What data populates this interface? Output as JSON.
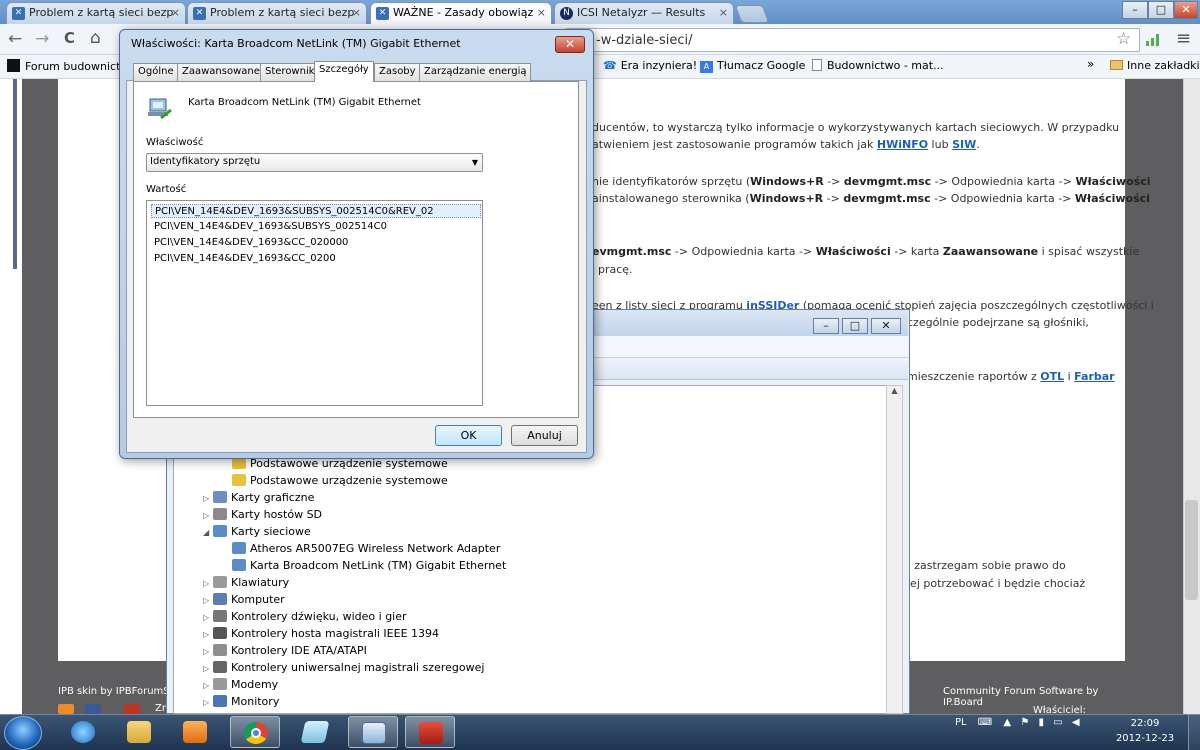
{
  "browser": {
    "tabs": [
      {
        "title": "Problem z kartą sieci bezp",
        "close": "×"
      },
      {
        "title": "Problem z kartą sieci bezp",
        "close": "×"
      },
      {
        "title": "WAŻNE - Zasady obowiąz",
        "close": "×"
      },
      {
        "title": "ICSI Netalyzr — Results",
        "close": "×"
      }
    ],
    "window_buttons": {
      "minimize": "–",
      "maximize": "□",
      "close": "✕"
    },
    "nav": {
      "back": "←",
      "forward": "→",
      "reload": "C",
      "home": "⌂",
      "star": "☆",
      "menu": "≡"
    },
    "url": "-w-dziale-sieci/",
    "bookmarks": {
      "first": "Forum budownictw",
      "items": [
        "Era inzyniera!",
        "Tłumacz Google",
        "Budownictwo - mat..."
      ],
      "chevron": "»",
      "other": "Inne zakładki"
    }
  },
  "page": {
    "lines": [
      {
        "segments": [
          {
            "t": "ducentów, to wystarczą tylko informacje o wykorzystywanych kartach sieciowych. W przypadku",
            "s": "n"
          }
        ]
      },
      {
        "segments": [
          {
            "t": "atwieniem jest zastosowanie programów takich jak ",
            "s": "n"
          },
          {
            "t": "HWiNFO",
            "s": "l"
          },
          {
            "t": " lub ",
            "s": "n"
          },
          {
            "t": "SIW",
            "s": "l"
          },
          {
            "t": ".",
            "s": "n"
          }
        ]
      },
      {
        "segments": [
          {
            "t": "nie identyfikatorów sprzętu (",
            "s": "n"
          },
          {
            "t": "Windows+R",
            "s": "b"
          },
          {
            "t": " -> ",
            "s": "n"
          },
          {
            "t": "devmgmt.msc",
            "s": "b"
          },
          {
            "t": " -> Odpowiednia karta -> ",
            "s": "n"
          },
          {
            "t": "Właściwości",
            "s": "b"
          }
        ]
      },
      {
        "segments": [
          {
            "t": "ainstalowanego sterownika (",
            "s": "n"
          },
          {
            "t": "Windows+R",
            "s": "b"
          },
          {
            "t": " -> ",
            "s": "n"
          },
          {
            "t": "devmgmt.msc",
            "s": "b"
          },
          {
            "t": " -> Odpowiednia karta -> ",
            "s": "n"
          },
          {
            "t": "Właściwości",
            "s": "b"
          }
        ]
      },
      {
        "segments": [
          {
            "t": "evmgmt.msc",
            "s": "b"
          },
          {
            "t": " -> Odpowiednia karta -> ",
            "s": "n"
          },
          {
            "t": "Właściwości",
            "s": "b"
          },
          {
            "t": " -> karta ",
            "s": "n"
          },
          {
            "t": "Zaawansowane",
            "s": "b"
          },
          {
            "t": " i spisać wszystkie",
            "s": "n"
          }
        ]
      },
      {
        "segments": [
          {
            "t": "pracę.",
            "s": "n"
          }
        ]
      },
      {
        "segments": [
          {
            "t": "een z listy sieci z programu ",
            "s": "n"
          },
          {
            "t": "inSSIDer",
            "s": "l"
          },
          {
            "t": " (pomaga ocenić stopień zajęcia poszczególnych częstotliwości i",
            "s": "n"
          }
        ]
      },
      {
        "segments": [
          {
            "t": "czególnie podejrzane są głośniki,",
            "s": "n"
          }
        ]
      },
      {
        "segments": [
          {
            "t": "mieszczenie raportów z ",
            "s": "n"
          },
          {
            "t": "OTL",
            "s": "l"
          },
          {
            "t": " i ",
            "s": "n"
          },
          {
            "t": "Farbar",
            "s": "l"
          }
        ]
      },
      {
        "segments": [
          {
            "t": "; zastrzegam sobie prawo do",
            "s": "n"
          }
        ]
      },
      {
        "segments": [
          {
            "t": " jej potrzebować i będzie chociaż",
            "s": "n"
          }
        ]
      }
    ],
    "footer_left": "IPB skin by IPBForumSki",
    "footer_right": "Community Forum Software by IP.Board",
    "footer_extra_left": "Zr",
    "footer_extra_right": "Właściciel: Fixitpc.pl"
  },
  "device_manager": {
    "window_buttons": {
      "minimize": "–",
      "maximize": "□",
      "close": "✕"
    },
    "tree": [
      {
        "label": "Podstawowe urządzenie systemowe",
        "level": 2,
        "icon": "warning-device-icon",
        "arrow": ""
      },
      {
        "label": "Podstawowe urządzenie systemowe",
        "level": 2,
        "icon": "warning-device-icon",
        "arrow": ""
      },
      {
        "label": "Karty graficzne",
        "level": 1,
        "icon": "display-adapter-icon",
        "arrow": "▷"
      },
      {
        "label": "Karty hostów SD",
        "level": 1,
        "icon": "sd-host-icon",
        "arrow": "▷"
      },
      {
        "label": "Karty sieciowe",
        "level": 1,
        "icon": "network-adapter-icon",
        "arrow": "◢"
      },
      {
        "label": "Atheros AR5007EG Wireless Network Adapter",
        "level": 2,
        "icon": "network-adapter-icon",
        "arrow": ""
      },
      {
        "label": "Karta Broadcom NetLink (TM) Gigabit Ethernet",
        "level": 2,
        "icon": "network-adapter-icon",
        "arrow": ""
      },
      {
        "label": "Klawiatury",
        "level": 1,
        "icon": "keyboard-icon",
        "arrow": "▷"
      },
      {
        "label": "Komputer",
        "level": 1,
        "icon": "computer-icon",
        "arrow": "▷"
      },
      {
        "label": "Kontrolery dźwięku, wideo i gier",
        "level": 1,
        "icon": "sound-icon",
        "arrow": "▷"
      },
      {
        "label": "Kontrolery hosta magistrali IEEE 1394",
        "level": 1,
        "icon": "ieee1394-icon",
        "arrow": "▷"
      },
      {
        "label": "Kontrolery IDE ATA/ATAPI",
        "level": 1,
        "icon": "ide-icon",
        "arrow": "▷"
      },
      {
        "label": "Kontrolery uniwersalnej magistrali szeregowej",
        "level": 1,
        "icon": "usb-icon",
        "arrow": "▷"
      },
      {
        "label": "Modemy",
        "level": 1,
        "icon": "modem-icon",
        "arrow": "▷"
      },
      {
        "label": "Monitory",
        "level": 1,
        "icon": "monitor-icon",
        "arrow": "▷"
      }
    ]
  },
  "dialog": {
    "title": "Właściwości: Karta Broadcom NetLink (TM) Gigabit Ethernet",
    "close": "✕",
    "tabs": [
      "Ogólne",
      "Zaawansowane",
      "Sterownik",
      "Szczegóły",
      "Zasoby",
      "Zarządzanie energią"
    ],
    "active_tab": "Szczegóły",
    "device_name": "Karta Broadcom NetLink (TM) Gigabit Ethernet",
    "property_label": "Właściwość",
    "property_value": "Identyfikatory sprzętu",
    "dropdown_arrow": "▼",
    "value_label": "Wartość",
    "values": [
      "PCI\\VEN_14E4&DEV_1693&SUBSYS_002514C0&REV_02",
      "PCI\\VEN_14E4&DEV_1693&SUBSYS_002514C0",
      "PCI\\VEN_14E4&DEV_1693&CC_020000",
      "PCI\\VEN_14E4&DEV_1693&CC_0200"
    ],
    "ok": "OK",
    "cancel": "Anuluj"
  },
  "taskbar": {
    "language": "PL",
    "time": "22:09",
    "date": "2012-12-23",
    "apps": [
      "internet-explorer-icon",
      "file-explorer-icon",
      "media-player-icon",
      "chrome-icon",
      "notepad-icon",
      "device-manager-icon",
      "toolbox-icon"
    ]
  }
}
